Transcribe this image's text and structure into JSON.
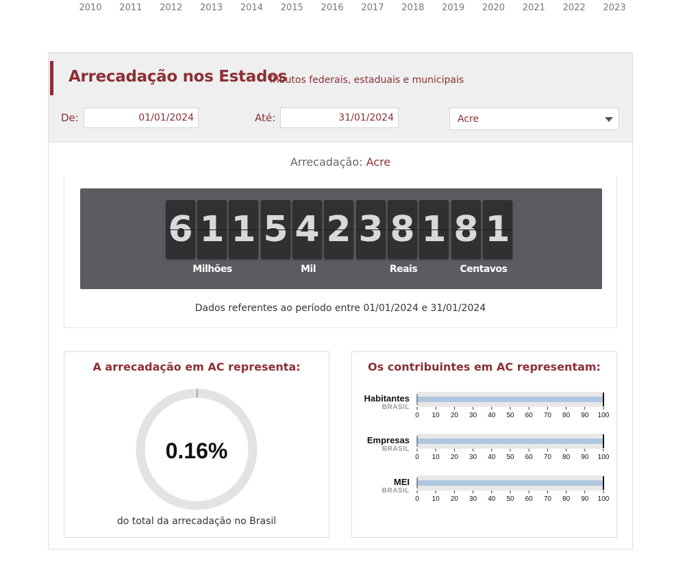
{
  "years": [
    "2010",
    "2011",
    "2012",
    "2013",
    "2014",
    "2015",
    "2016",
    "2017",
    "2018",
    "2019",
    "2020",
    "2021",
    "2022",
    "2023"
  ],
  "header": {
    "title": "Arrecadação nos Estados",
    "subtitle": "- Tributos federais, estaduais e municipais"
  },
  "filters": {
    "from_label": "De:",
    "from_value": "01/01/2024",
    "to_label": "Até:",
    "to_value": "31/01/2024",
    "state_value": "Acre"
  },
  "summary": {
    "title_prefix": "Arrecadação:",
    "state": "Acre"
  },
  "counter": {
    "digits": [
      "6",
      "1",
      "1",
      "5",
      "4",
      "2",
      "3",
      "8",
      "1",
      "8",
      "1"
    ],
    "units": [
      "Milhões",
      "Mil",
      "Reais",
      "Centavos"
    ],
    "period_text": "Dados referentes ao período entre 01/01/2024 e 31/01/2024"
  },
  "share_card": {
    "title": "A arrecadação em AC representa:",
    "percent": "0.16%",
    "percent_value": 0.16,
    "footer": "do total da arrecadação no Brasil",
    "ring_color": "#e3e3e3",
    "marker_color": "#6f9fd8"
  },
  "contrib_card": {
    "title": "Os contribuintes em AC representam:"
  },
  "chart_data": {
    "type": "bar",
    "orientation": "horizontal",
    "categories": [
      "Habitantes",
      "Empresas",
      "MEI"
    ],
    "category_sublabel": "BRASIL",
    "series": [
      {
        "name": "BRASIL",
        "values": [
          100,
          100,
          100
        ]
      }
    ],
    "xlim": [
      0,
      100
    ],
    "ticks": [
      "0",
      "10",
      "20",
      "30",
      "40",
      "50",
      "60",
      "70",
      "80",
      "90",
      "100"
    ],
    "bar_color": "#b0c6e0",
    "track_color": "#e8e8e8",
    "grid": false
  },
  "colors": {
    "brand": "#8c2f35",
    "counter_bg": "#5b5b62",
    "digit_bg": "#303032"
  }
}
